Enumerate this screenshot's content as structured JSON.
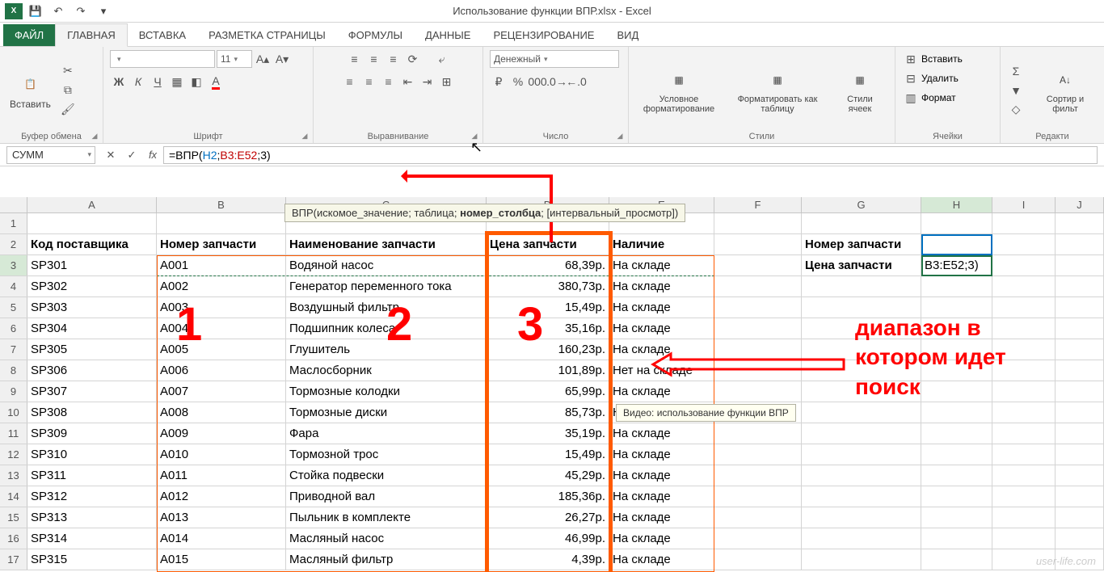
{
  "app": {
    "title": "Использование функции ВПР.xlsx - Excel",
    "qat": {
      "save": "💾",
      "undo": "↶",
      "redo": "↷"
    }
  },
  "tabs": {
    "file": "ФАЙЛ",
    "home": "ГЛАВНАЯ",
    "insert": "ВСТАВКА",
    "layout": "РАЗМЕТКА СТРАНИЦЫ",
    "formulas": "ФОРМУЛЫ",
    "data": "ДАННЫЕ",
    "review": "РЕЦЕНЗИРОВАНИЕ",
    "view": "ВИД"
  },
  "ribbon": {
    "clipboard": {
      "paste": "Вставить",
      "label": "Буфер обмена"
    },
    "font": {
      "size": "11",
      "label": "Шрифт",
      "bold": "Ж",
      "italic": "К",
      "underline": "Ч"
    },
    "align": {
      "label": "Выравнивание"
    },
    "number": {
      "format": "Денежный",
      "label": "Число",
      "percent": "%",
      "thousands": "000"
    },
    "styles": {
      "cond": "Условное форматирование",
      "table": "Форматировать как таблицу",
      "cell": "Стили ячеек",
      "label": "Стили"
    },
    "cells": {
      "insert": "Вставить",
      "delete": "Удалить",
      "format": "Формат",
      "label": "Ячейки"
    },
    "editing": {
      "sort": "Сортир и фильт",
      "label": "Редакти"
    }
  },
  "formula_bar": {
    "name_box": "СУММ",
    "formula_prefix": "=ВПР(",
    "arg1": "H2",
    "sep1": ";",
    "arg2": "B3:E52",
    "sep2": ";",
    "arg3": "3)",
    "fn_tip": {
      "pre": "ВПР(искомое_значение; таблица; ",
      "bold": "номер_столбца",
      "post": "; [интервальный_просмотр])"
    }
  },
  "columns": [
    "A",
    "B",
    "C",
    "D",
    "E",
    "F",
    "G",
    "H",
    "I",
    "J"
  ],
  "headers": {
    "A": "Код поставщика",
    "B": "Номер запчасти",
    "C": "Наименование запчасти",
    "D": "Цена запчасти",
    "E": "Наличие",
    "G2": "Номер запчасти",
    "G3": "Цена запчасти",
    "H3": "B3:E52;3)"
  },
  "rows": [
    {
      "n": 1
    },
    {
      "n": 2
    },
    {
      "n": 3,
      "A": "SP301",
      "B": "A001",
      "C": "Водяной насос",
      "D": "68,39р.",
      "E": "На складе"
    },
    {
      "n": 4,
      "A": "SP302",
      "B": "A002",
      "C": "Генератор переменного тока",
      "D": "380,73р.",
      "E": "На складе"
    },
    {
      "n": 5,
      "A": "SP303",
      "B": "A003",
      "C": "Воздушный фильтр",
      "D": "15,49р.",
      "E": "На складе"
    },
    {
      "n": 6,
      "A": "SP304",
      "B": "A004",
      "C": "Подшипник колеса",
      "D": "35,16р.",
      "E": "На складе"
    },
    {
      "n": 7,
      "A": "SP305",
      "B": "A005",
      "C": "Глушитель",
      "D": "160,23р.",
      "E": "На складе"
    },
    {
      "n": 8,
      "A": "SP306",
      "B": "A006",
      "C": "Маслосборник",
      "D": "101,89р.",
      "E": "Нет на складе"
    },
    {
      "n": 9,
      "A": "SP307",
      "B": "A007",
      "C": "Тормозные колодки",
      "D": "65,99р.",
      "E": "На складе"
    },
    {
      "n": 10,
      "A": "SP308",
      "B": "A008",
      "C": "Тормозные диски",
      "D": "85,73р.",
      "E": "Нет на складе"
    },
    {
      "n": 11,
      "A": "SP309",
      "B": "A009",
      "C": "Фара",
      "D": "35,19р.",
      "E": "На складе"
    },
    {
      "n": 12,
      "A": "SP310",
      "B": "A010",
      "C": "Тормозной трос",
      "D": "15,49р.",
      "E": "На складе"
    },
    {
      "n": 13,
      "A": "SP311",
      "B": "A011",
      "C": "Стойка подвески",
      "D": "45,29р.",
      "E": "На складе"
    },
    {
      "n": 14,
      "A": "SP312",
      "B": "A012",
      "C": "Приводной вал",
      "D": "185,36р.",
      "E": "На складе"
    },
    {
      "n": 15,
      "A": "SP313",
      "B": "A013",
      "C": "Пыльник в комплекте",
      "D": "26,27р.",
      "E": "На складе"
    },
    {
      "n": 16,
      "A": "SP314",
      "B": "A014",
      "C": "Масляный насос",
      "D": "46,99р.",
      "E": "На складе"
    },
    {
      "n": 17,
      "A": "SP315",
      "B": "A015",
      "C": "Масляный фильтр",
      "D": "4,39р.",
      "E": "На складе"
    }
  ],
  "annotations": {
    "n1": "1",
    "n2": "2",
    "n3": "3",
    "text_l1": "диапазон в",
    "text_l2": "котором идет",
    "text_l3": "поиск",
    "video_tip": "Видео: использование функции ВПР"
  },
  "watermark": "user-life.com"
}
